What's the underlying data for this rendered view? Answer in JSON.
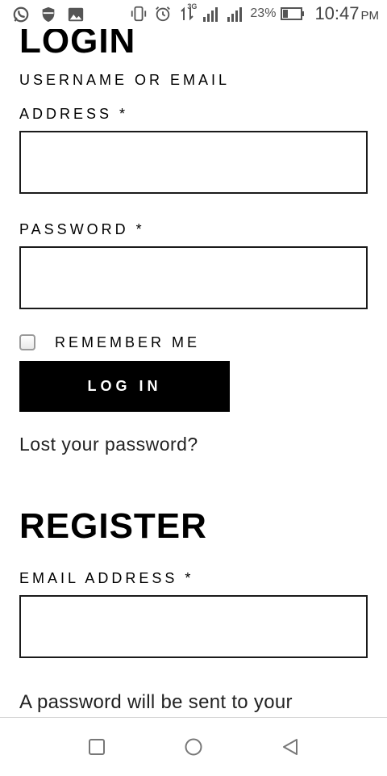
{
  "status_bar": {
    "battery_percent": "23%",
    "time": "10:47",
    "ampm": "PM",
    "network_label": "3G",
    "icons": [
      "whatsapp-icon",
      "shield-icon",
      "image-icon",
      "vibrate-icon",
      "alarm-icon",
      "data-arrows-icon",
      "signal-icon",
      "signal-icon-2",
      "battery-icon"
    ]
  },
  "login": {
    "title": "LOGIN",
    "username_label_line1": "USERNAME OR EMAIL",
    "username_label_line2": "ADDRESS *",
    "username_value": "",
    "password_label": "PASSWORD *",
    "password_value": "",
    "remember_label": "REMEMBER ME",
    "remember_checked": false,
    "login_button": "LOG IN",
    "lost_password": "Lost your password?"
  },
  "register": {
    "title": "REGISTER",
    "email_label": "EMAIL ADDRESS *",
    "email_value": "",
    "note": "A password will be sent to your"
  },
  "nav_bar": {
    "icons": [
      "recent-apps-icon",
      "home-icon",
      "back-icon"
    ]
  },
  "colors": {
    "button_bg": "#000000",
    "button_text": "#ffffff",
    "border": "#1a1a1a",
    "status_text": "#555555"
  }
}
